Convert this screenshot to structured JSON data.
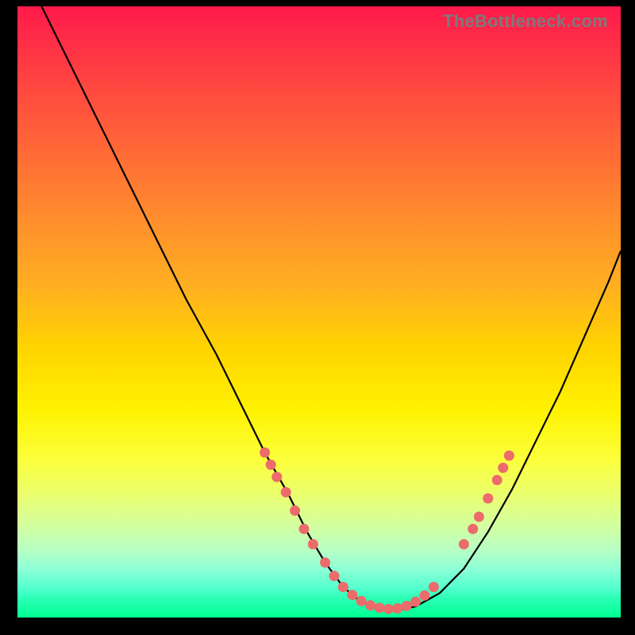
{
  "watermark": "TheBottleneck.com",
  "chart_data": {
    "type": "line",
    "title": "",
    "xlabel": "",
    "ylabel": "",
    "xlim": [
      0,
      100
    ],
    "ylim": [
      0,
      100
    ],
    "series": [
      {
        "name": "bottleneck-curve",
        "x": [
          4,
          8,
          13,
          18,
          23,
          28,
          33,
          37,
          41,
          45,
          48,
          51,
          54,
          57,
          60,
          63,
          66,
          70,
          74,
          78,
          82,
          86,
          90,
          94,
          98,
          100
        ],
        "y": [
          100,
          92,
          82,
          72,
          62,
          52,
          43,
          35,
          27,
          20,
          14,
          9,
          5,
          2.5,
          1.5,
          1.2,
          1.8,
          4,
          8,
          14,
          21,
          29,
          37,
          46,
          55,
          60
        ]
      }
    ],
    "markers": {
      "name": "highlight-dots",
      "color": "#ec6b6b",
      "points": [
        {
          "x": 41,
          "y": 27
        },
        {
          "x": 42,
          "y": 25
        },
        {
          "x": 43,
          "y": 23
        },
        {
          "x": 44.5,
          "y": 20.5
        },
        {
          "x": 46,
          "y": 17.5
        },
        {
          "x": 47.5,
          "y": 14.5
        },
        {
          "x": 49,
          "y": 12
        },
        {
          "x": 51,
          "y": 9
        },
        {
          "x": 52.5,
          "y": 6.8
        },
        {
          "x": 54,
          "y": 5
        },
        {
          "x": 55.5,
          "y": 3.7
        },
        {
          "x": 57,
          "y": 2.7
        },
        {
          "x": 58.5,
          "y": 2
        },
        {
          "x": 60,
          "y": 1.6
        },
        {
          "x": 61.5,
          "y": 1.4
        },
        {
          "x": 63,
          "y": 1.5
        },
        {
          "x": 64.5,
          "y": 1.9
        },
        {
          "x": 66,
          "y": 2.6
        },
        {
          "x": 67.5,
          "y": 3.6
        },
        {
          "x": 69,
          "y": 5
        },
        {
          "x": 74,
          "y": 12
        },
        {
          "x": 75.5,
          "y": 14.5
        },
        {
          "x": 76.5,
          "y": 16.5
        },
        {
          "x": 78,
          "y": 19.5
        },
        {
          "x": 79.5,
          "y": 22.5
        },
        {
          "x": 80.5,
          "y": 24.5
        },
        {
          "x": 81.5,
          "y": 26.5
        }
      ]
    }
  }
}
